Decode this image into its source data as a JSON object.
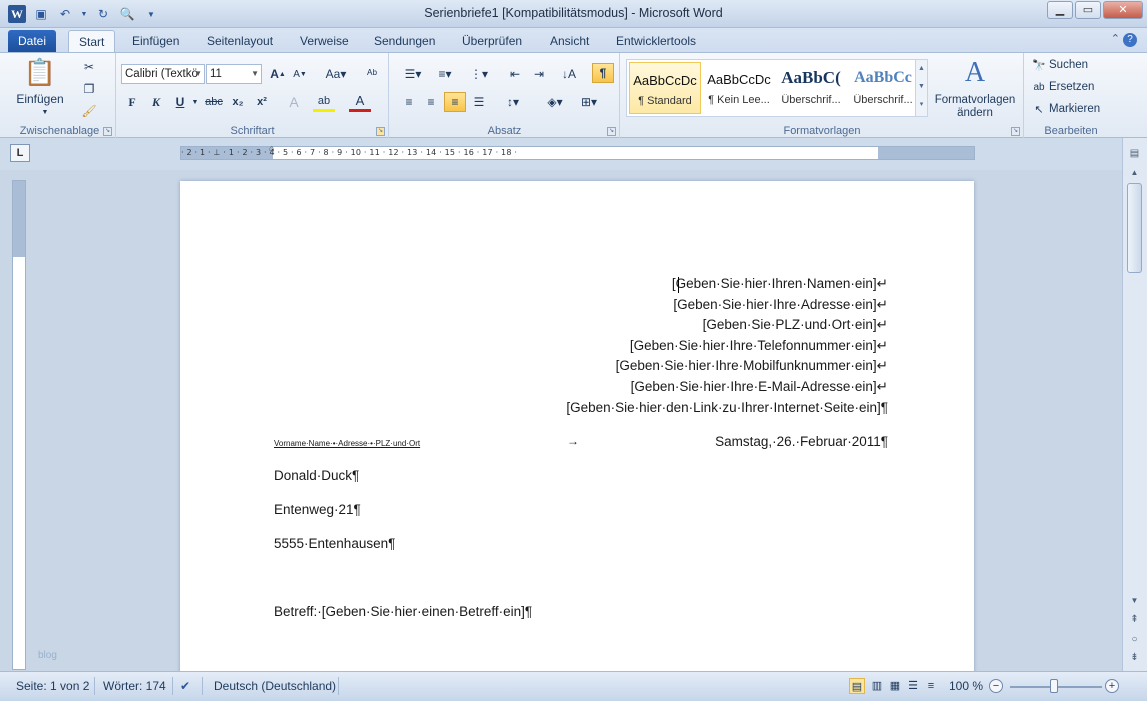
{
  "window": {
    "title": "Serienbriefe1 [Kompatibilitätsmodus] - Microsoft Word",
    "minimize": "▁",
    "maximize": "▭",
    "close": "✕"
  },
  "qat": {
    "icons": [
      "word-logo",
      "save-icon",
      "undo-icon",
      "redo-icon",
      "print-preview-icon",
      "customize-qat-icon"
    ]
  },
  "tabs": [
    "Datei",
    "Start",
    "Einfügen",
    "Seitenlayout",
    "Verweise",
    "Sendungen",
    "Überprüfen",
    "Ansicht",
    "Entwicklertools"
  ],
  "active_tab": "Start",
  "ribbon": {
    "clipboard": {
      "label": "Zwischenablage",
      "paste": "Einfügen"
    },
    "font": {
      "label": "Schriftart",
      "family": "Calibri (Textkö",
      "size": "11",
      "bold": "F",
      "italic": "K",
      "underline": "U",
      "strike": "abc",
      "subscript": "x₂",
      "superscript": "x²"
    },
    "paragraph": {
      "label": "Absatz",
      "pilcrow": "¶"
    },
    "styles": {
      "label": "Formatvorlagen",
      "items": [
        {
          "sample": "AaBbCcDc",
          "name": "¶ Standard"
        },
        {
          "sample": "AaBbCcDc",
          "name": "¶ Kein Lee..."
        },
        {
          "sample": "AaBbC(",
          "name": "Überschrif..."
        },
        {
          "sample": "AaBbCc",
          "name": "Überschrif..."
        }
      ],
      "change_line1": "Formatvorlagen",
      "change_line2": "ändern"
    },
    "editing": {
      "label": "Bearbeiten",
      "find": "Suchen",
      "replace": "Ersetzen",
      "select": "Markieren"
    }
  },
  "ruler": {
    "ticks": "· 2 · 1 · ⊥ · 1 · 2 · 3 · 4 · 5 · 6 · 7 · 8 · 9 · 10 · 11 · 12 · 13 · 14 · 15 · 16 · 17 · 18 ·"
  },
  "document": {
    "sender_lines": [
      "[Geben·Sie·hier·Ihren·Namen·ein]↵",
      "[Geben·Sie·hier·Ihre·Adresse·ein]↵",
      "[Geben·Sie·PLZ·und·Ort·ein]↵",
      "[Geben·Sie·hier·Ihre·Telefonnummer·ein]↵",
      "[Geben·Sie·hier·Ihre·Mobilfunknummer·ein]↵",
      "[Geben·Sie·hier·Ihre·E-Mail-Adresse·ein]↵",
      "[Geben·Sie·hier·den·Link·zu·Ihrer·Internet·Seite·ein]¶"
    ],
    "sender_small": "Vorname·Name·•·Adresse·•·PLZ·und·Ort",
    "tab_arrow": "→",
    "date": "Samstag,·26.·Februar·2011¶",
    "recipient": [
      "Donald·Duck¶",
      "Entenweg·21¶",
      "5555·Entenhausen¶"
    ],
    "subject": "Betreff:·[Geben·Sie·hier·einen·Betreff·ein]¶"
  },
  "watermark": "blog",
  "statusbar": {
    "page": "Seite: 1 von 2",
    "words": "Wörter: 174",
    "language": "Deutsch (Deutschland)",
    "zoom": "100 %",
    "zoom_level_percent": 100
  }
}
